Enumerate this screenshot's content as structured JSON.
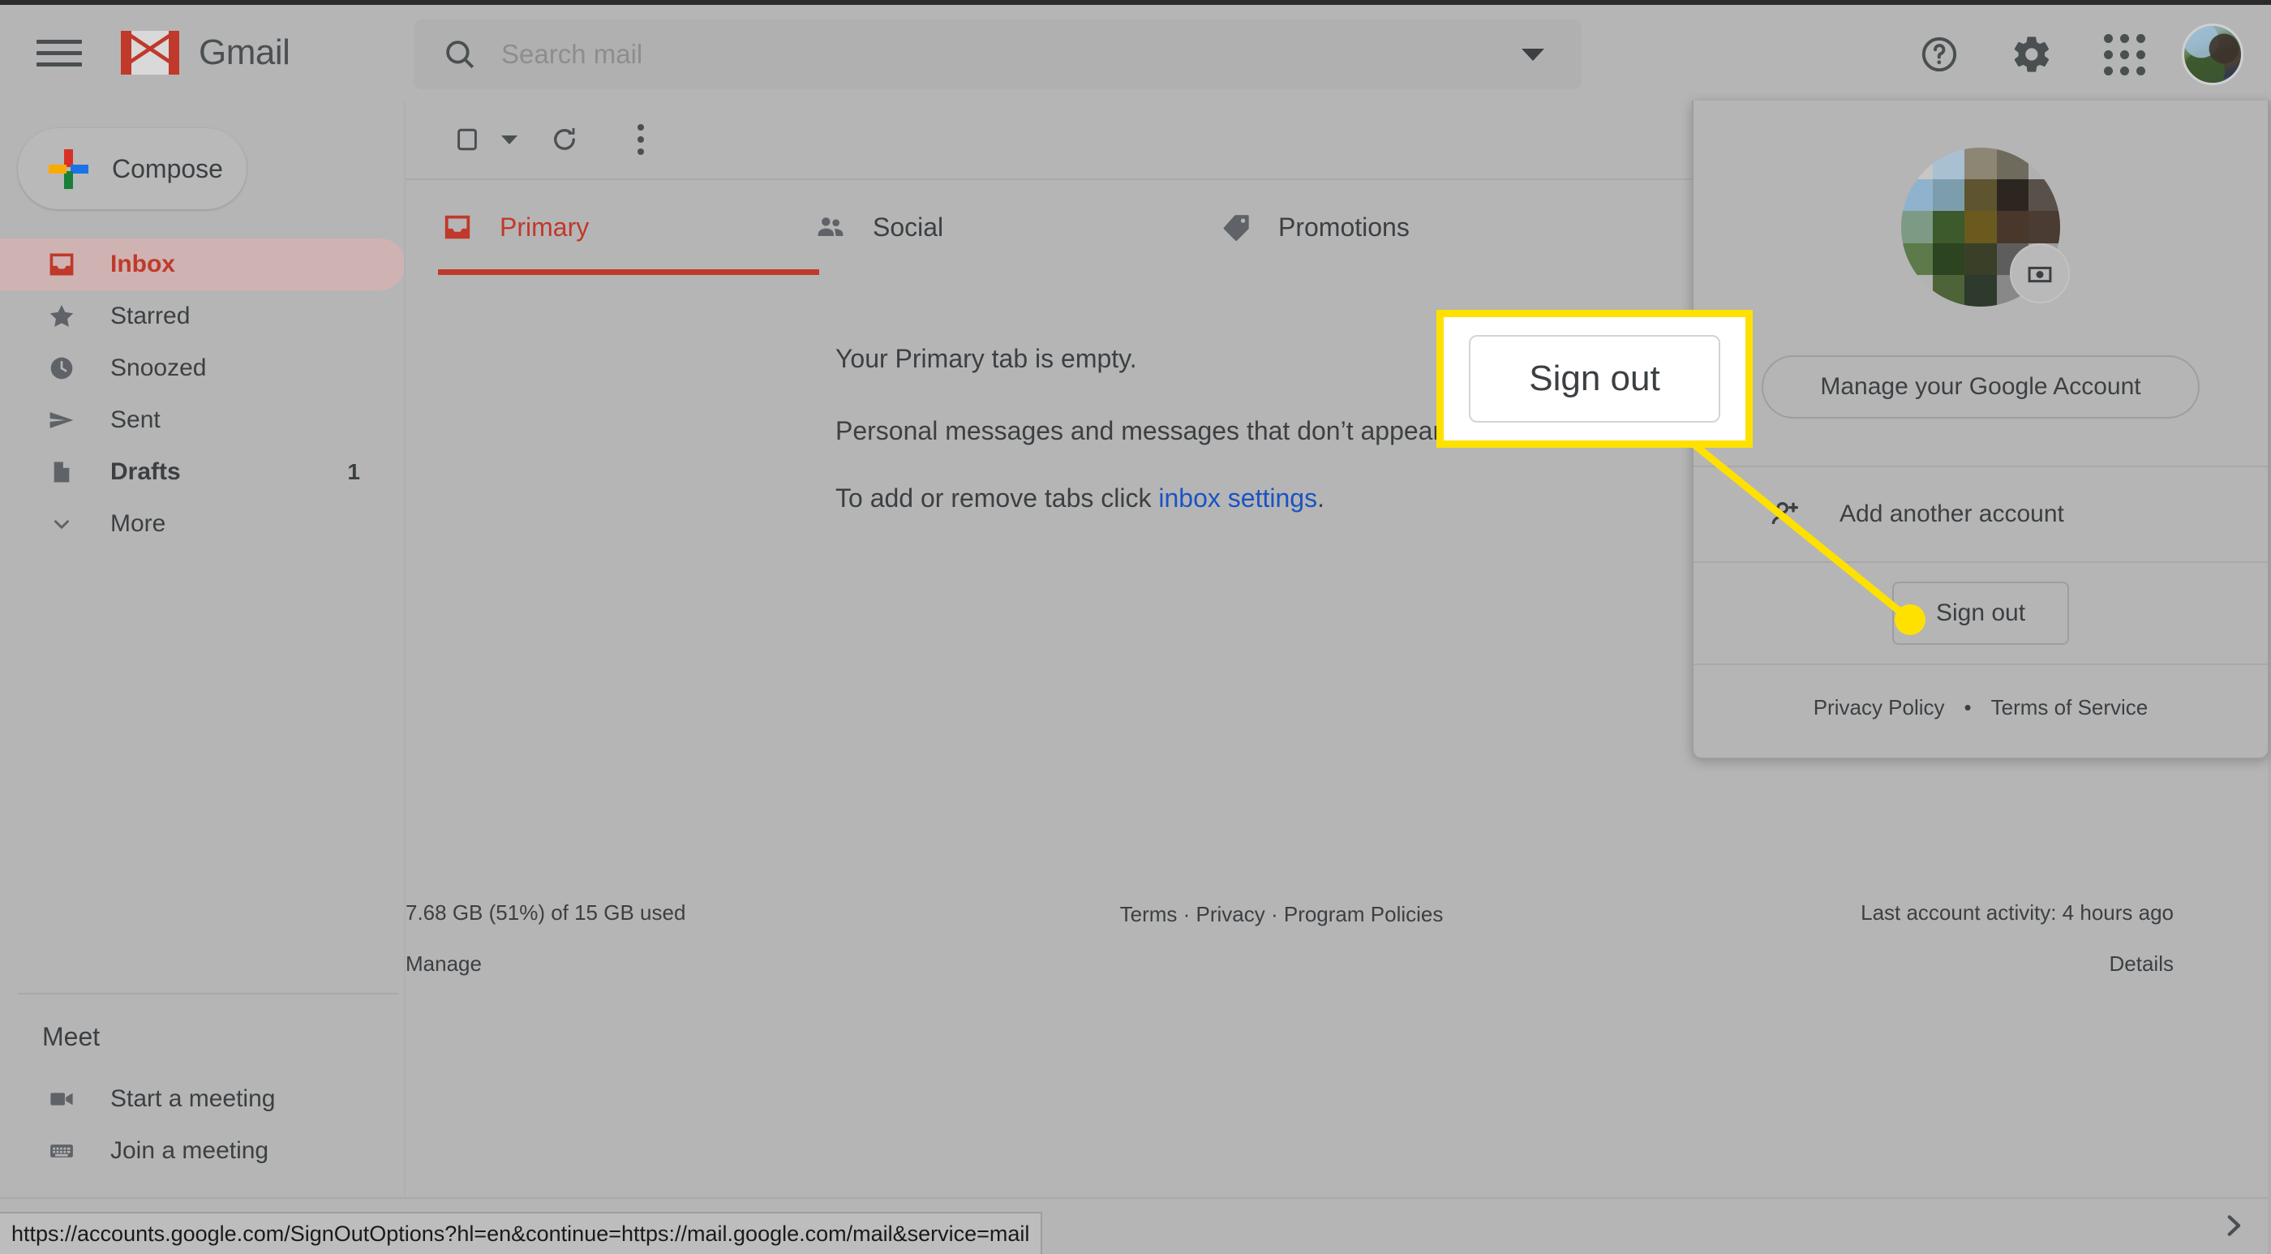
{
  "app": {
    "brand": "Gmail"
  },
  "header": {
    "menu_icon": "hamburger-icon",
    "search": {
      "placeholder": "Search mail",
      "value": "",
      "icon": "search-icon",
      "caret": "chevron-down-icon"
    },
    "help_icon": "help-circle-icon",
    "settings_icon": "gear-icon",
    "apps_icon": "apps-grid-icon",
    "avatar_icon": "user-avatar"
  },
  "sidebar": {
    "compose": {
      "label": "Compose",
      "icon": "plus-icon"
    },
    "items": [
      {
        "label": "Inbox",
        "icon": "inbox-icon",
        "count": "",
        "active": true
      },
      {
        "label": "Starred",
        "icon": "star-icon",
        "count": "",
        "active": false
      },
      {
        "label": "Snoozed",
        "icon": "clock-icon",
        "count": "",
        "active": false
      },
      {
        "label": "Sent",
        "icon": "send-icon",
        "count": "",
        "active": false
      },
      {
        "label": "Drafts",
        "icon": "draft-icon",
        "count": "1",
        "active": false
      },
      {
        "label": "More",
        "icon": "chevron-down-icon",
        "count": "",
        "active": false
      }
    ],
    "meet": {
      "title": "Meet",
      "items": [
        {
          "label": "Start a meeting",
          "icon": "video-camera-icon"
        },
        {
          "label": "Join a meeting",
          "icon": "keyboard-icon"
        }
      ]
    }
  },
  "toolbar": {
    "select_all": "select-checkbox",
    "select_caret": "chevron-down-icon",
    "refresh_icon": "refresh-icon",
    "more_icon": "kebab-menu-icon"
  },
  "tabs": [
    {
      "label": "Primary",
      "icon": "inbox-icon",
      "active": true
    },
    {
      "label": "Social",
      "icon": "people-icon",
      "active": false
    },
    {
      "label": "Promotions",
      "icon": "tag-icon",
      "active": false
    }
  ],
  "empty_state": {
    "line1": "Your Primary tab is empty.",
    "line2": "Personal messages and messages that don’t appear in other tabs will be shown here.",
    "line3_prefix": "To add or remove tabs click ",
    "line3_link": "inbox settings",
    "line3_suffix": "."
  },
  "footer": {
    "storage": "7.68 GB (51%) of 15 GB used",
    "manage": "Manage",
    "links": "Terms · Privacy · Program Policies",
    "activity": "Last account activity: 4 hours ago",
    "details": "Details"
  },
  "account_panel": {
    "avatar_icon": "user-avatar",
    "camera_badge_icon": "camera-icon",
    "manage_account": "Manage your Google Account",
    "add_account": {
      "label": "Add another account",
      "icon": "add-person-icon"
    },
    "sign_out": "Sign out",
    "privacy_policy": "Privacy Policy",
    "separator": "•",
    "terms_of_service": "Terms of Service"
  },
  "callout": {
    "label": "Sign out",
    "border_color": "#ffe100",
    "dot_color": "#ffe100"
  },
  "statusbar": {
    "url": "https://accounts.google.com/SignOutOptions?hl=en&continue=https://mail.google.com/mail&service=mail"
  },
  "bottom_chevron_icon": "chevron-right-icon",
  "colors": {
    "page_bg": "#b5b5b5",
    "accent_red": "#c0392b",
    "link_blue": "#1a53c4",
    "highlight_yellow": "#ffe100"
  }
}
